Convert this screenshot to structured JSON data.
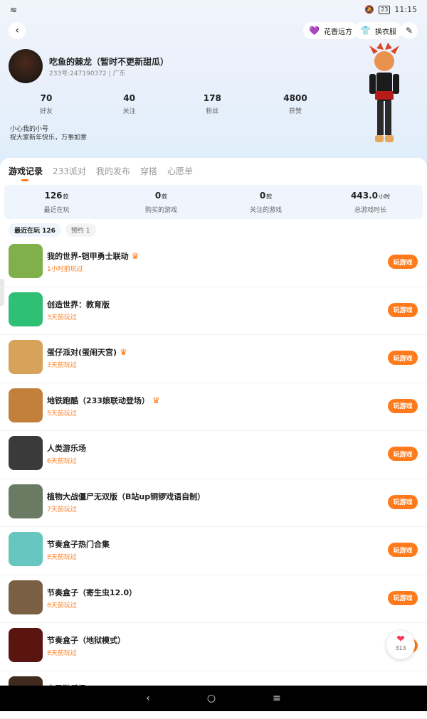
{
  "status_bar": {
    "left_icons": "wifi",
    "battery": "23",
    "time": "11:15"
  },
  "header": {
    "back_icon": "chevron-left-icon",
    "buttons": [
      {
        "label": "花香远方",
        "icon": "heart-icon"
      },
      {
        "label": "换衣服",
        "icon": "shirt-icon"
      }
    ],
    "edit_icon": "pencil-icon"
  },
  "profile": {
    "nickname": "吃鱼的棘龙（暂时不更新甜瓜）",
    "id_line": "233号:247190372 | 广东",
    "stats": [
      {
        "value": "70",
        "label": "好友"
      },
      {
        "value": "40",
        "label": "关注"
      },
      {
        "value": "178",
        "label": "粉丝"
      },
      {
        "value": "4800",
        "label": "获赞"
      }
    ],
    "bio": [
      "小心我的小号",
      "祝大家新年快乐，万事如意"
    ]
  },
  "tabs": {
    "active_index": 0,
    "items": [
      "游戏记录",
      "233派对",
      "我的发布",
      "穿搭",
      "心愿单"
    ]
  },
  "summary": [
    {
      "value": "126",
      "unit": "款",
      "label": "最近在玩"
    },
    {
      "value": "0",
      "unit": "款",
      "label": "购买的游戏"
    },
    {
      "value": "0",
      "unit": "款",
      "label": "关注的游戏"
    },
    {
      "value": "443.0",
      "unit": "小时",
      "label": "总游戏时长"
    }
  ],
  "filters": [
    {
      "label": "最近在玩 126",
      "active": true
    },
    {
      "label": "预约 1",
      "active": false
    }
  ],
  "games": [
    {
      "title": "我的世界-铠甲勇士联动",
      "time": "1小时前玩过",
      "crown": true,
      "color": "#7fb04a"
    },
    {
      "title": "创造世界：教育版",
      "time": "3天前玩过",
      "crown": false,
      "color": "#2fbf75"
    },
    {
      "title": "蛋仔派对(蛋闹天宫)",
      "time": "3天前玩过",
      "crown": true,
      "color": "#d7a25a"
    },
    {
      "title": "地铁跑酷（233娘联动登场）",
      "time": "5天前玩过",
      "crown": true,
      "color": "#c3803a"
    },
    {
      "title": "人类游乐场",
      "time": "6天前玩过",
      "crown": false,
      "color": "#3a3a3a"
    },
    {
      "title": "植物大战僵尸无双版（B站up铜锣戏语自制）",
      "time": "7天前玩过",
      "crown": false,
      "color": "#6b7a63"
    },
    {
      "title": "节奏盒子热门合集",
      "time": "8天前玩过",
      "crown": false,
      "color": "#67c6c0"
    },
    {
      "title": "节奏盒子（寄生虫12.0）",
      "time": "8天前玩过",
      "crown": false,
      "color": "#7a5f45"
    },
    {
      "title": "节奏盒子（地狱模式）",
      "time": "8天前玩过",
      "crown": false,
      "color": "#5b1510"
    },
    {
      "title": "水果游乐场",
      "time": "",
      "crown": false,
      "color": "#3f2a1d"
    }
  ],
  "play_label": "玩游戏",
  "float_like": {
    "count": "313"
  },
  "nav": {
    "back": "‹",
    "home": "○",
    "menu": "≡"
  }
}
